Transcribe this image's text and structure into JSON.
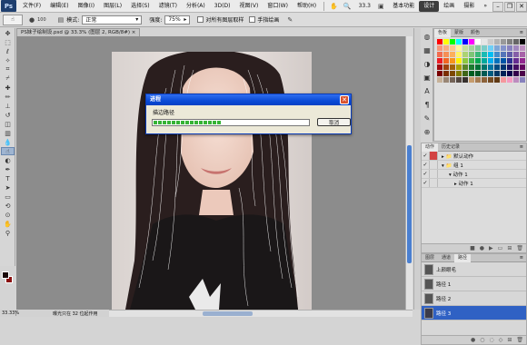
{
  "menubar": {
    "logo": "Ps",
    "items": [
      "文件(F)",
      "编辑(E)",
      "图像(I)",
      "图层(L)",
      "选择(S)",
      "滤镜(T)",
      "分析(A)",
      "3D(D)",
      "视图(V)",
      "窗口(W)",
      "帮助(H)"
    ],
    "zoom": "33.3",
    "workspaces": [
      "基本功能",
      "设计",
      "绘画",
      "摄影"
    ],
    "active_workspace": "设计",
    "more": "»"
  },
  "options": {
    "brush_size": "100",
    "mode_label": "模式:",
    "mode_value": "正常",
    "opacity_label": "强度:",
    "opacity_value": "75%",
    "sample_all": "对所有图层取样",
    "finger_paint": "手指绘画"
  },
  "document_tab": "PS妹子绘制设.psd @ 33.3% (图层 2, RGB/8#) ×",
  "status": {
    "zoom": "33.33%",
    "info": "曝光只在 32 位起作用"
  },
  "dialog": {
    "title": "进程",
    "message": "描边路径",
    "progress": 0.42,
    "cancel_label": "取消",
    "close_glyph": "✕"
  },
  "swatch_panel": {
    "tabs": [
      "色板",
      "蒙版",
      "颜色"
    ],
    "colors": [
      "#ff0000",
      "#ffff00",
      "#00ff00",
      "#00ffff",
      "#0000ff",
      "#ff00ff",
      "#ffffff",
      "#e6e6e6",
      "#cccccc",
      "#b3b3b3",
      "#999999",
      "#808080",
      "#666666",
      "#000000",
      "#f7977a",
      "#f9ad81",
      "#fdc68a",
      "#fff79a",
      "#c4df9b",
      "#a3d39c",
      "#82ca9d",
      "#7bcdc8",
      "#6ecff6",
      "#7ea7d8",
      "#8493ca",
      "#8882be",
      "#a187be",
      "#bc8dbf",
      "#f26c4f",
      "#f68e55",
      "#fbaf5c",
      "#fff467",
      "#acd372",
      "#7cc576",
      "#3bb878",
      "#1abbb4",
      "#00bff3",
      "#438cca",
      "#5574b9",
      "#605ca8",
      "#855fa8",
      "#a763a8",
      "#ed1c24",
      "#f26522",
      "#f7941d",
      "#fff200",
      "#8dc73f",
      "#39b54a",
      "#00a651",
      "#00a99d",
      "#00aeef",
      "#0072bc",
      "#0054a6",
      "#2e3192",
      "#662d91",
      "#92278f",
      "#9e0b0f",
      "#a0410d",
      "#a36209",
      "#aba000",
      "#598527",
      "#1a7b30",
      "#007236",
      "#00746b",
      "#0076a3",
      "#004b80",
      "#003471",
      "#1b1464",
      "#440e62",
      "#630460",
      "#790000",
      "#7b2e00",
      "#7d4900",
      "#827b00",
      "#406618",
      "#005e20",
      "#005826",
      "#005952",
      "#005b7f",
      "#003663",
      "#002157",
      "#0d004c",
      "#32004b",
      "#4b0049",
      "#c7b299",
      "#998675",
      "#736357",
      "#534741",
      "#37302d",
      "#c69c6d",
      "#a67c52",
      "#8c6239",
      "#754c24",
      "#603913",
      "#f5989d",
      "#f49ac1",
      "#bd8cbf",
      "#8781bd"
    ]
  },
  "actions_panel": {
    "tabs": [
      "动作",
      "历史记录"
    ],
    "rows": [
      {
        "label": "默认动作",
        "indent": 1,
        "red": true
      },
      {
        "label": "组 1",
        "indent": 1,
        "red": false
      },
      {
        "label": "动作 1",
        "indent": 2,
        "red": false
      },
      {
        "label": "动作 1",
        "indent": 3,
        "red": false
      }
    ]
  },
  "paths_panel": {
    "tabs": [
      "图层",
      "通道",
      "路径"
    ],
    "active_tab": "路径",
    "rows": [
      {
        "label": "上颜眼毛",
        "selected": false
      },
      {
        "label": "路径 1",
        "selected": false
      },
      {
        "label": "路径 2",
        "selected": false
      },
      {
        "label": "路径 3",
        "selected": true
      }
    ]
  },
  "tools": [
    "move",
    "marquee",
    "lasso",
    "magic-wand",
    "crop",
    "eyedropper",
    "heal",
    "brush",
    "clone",
    "history-brush",
    "eraser",
    "gradient",
    "blur",
    "dodge",
    "pen",
    "type",
    "path-select",
    "shape",
    "3d-rotate",
    "3d-camera",
    "hand",
    "zoom"
  ]
}
